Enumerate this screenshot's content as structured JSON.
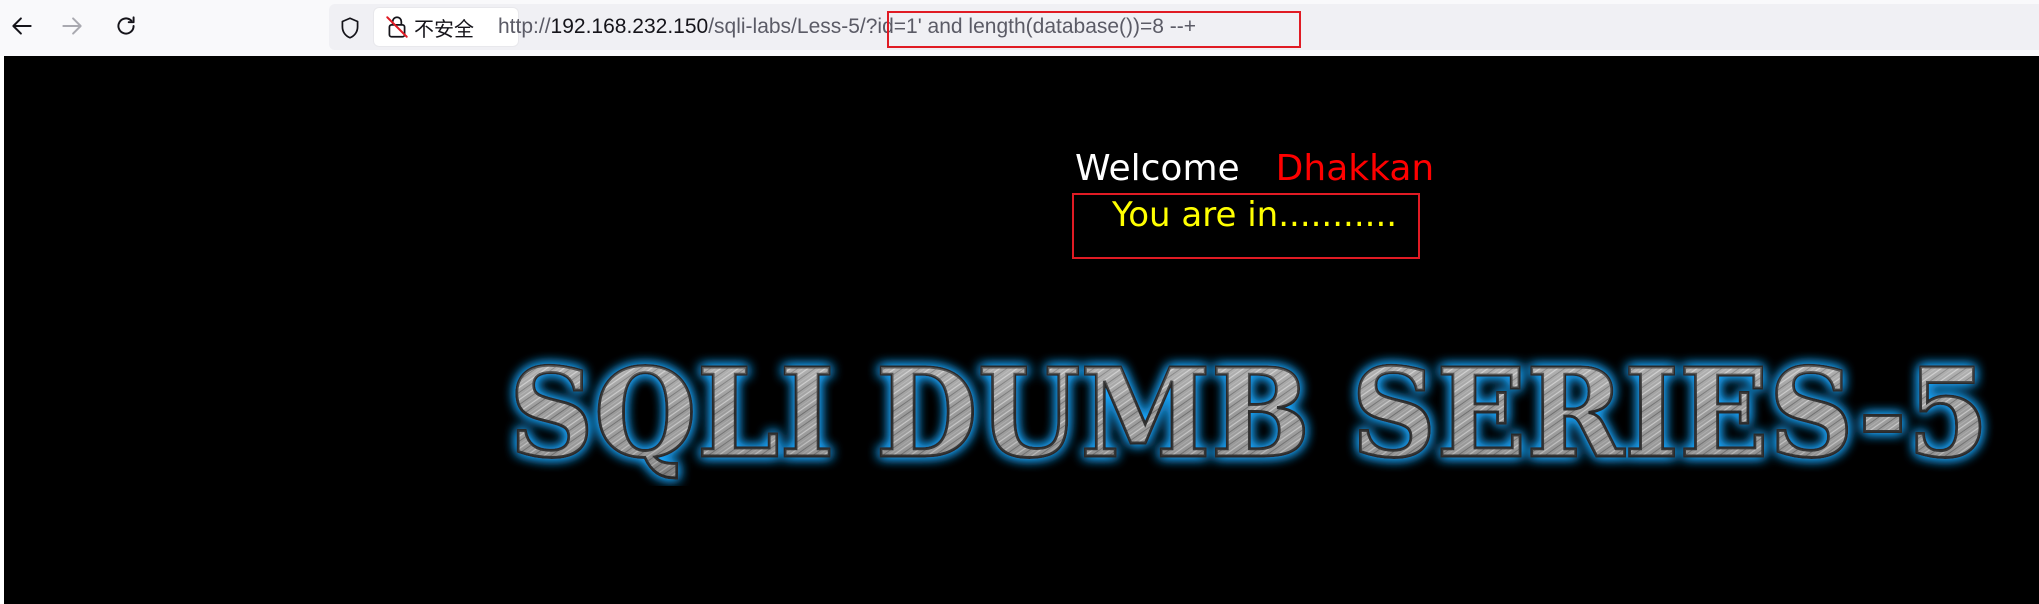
{
  "browser": {
    "back_icon": "arrow-left-icon",
    "forward_icon": "arrow-right-icon",
    "reload_icon": "reload-icon",
    "security_label": "不安全",
    "url_scheme": "http://",
    "url_host": "192.168.232.150",
    "url_path": "/sqli-labs/Less-5/",
    "url_query": "?id=1' and length(database())=8 --+",
    "highlight_color": "#e01b24"
  },
  "page": {
    "welcome": "Welcome",
    "user": "Dhakkan",
    "status": "You are in...........",
    "banner_title": "SQLI DUMB SERIES-5",
    "colors": {
      "background": "#000000",
      "welcome": "#ffffff",
      "user": "#ff0000",
      "status": "#ffff00",
      "banner_glow": "#1fa8ff"
    }
  }
}
